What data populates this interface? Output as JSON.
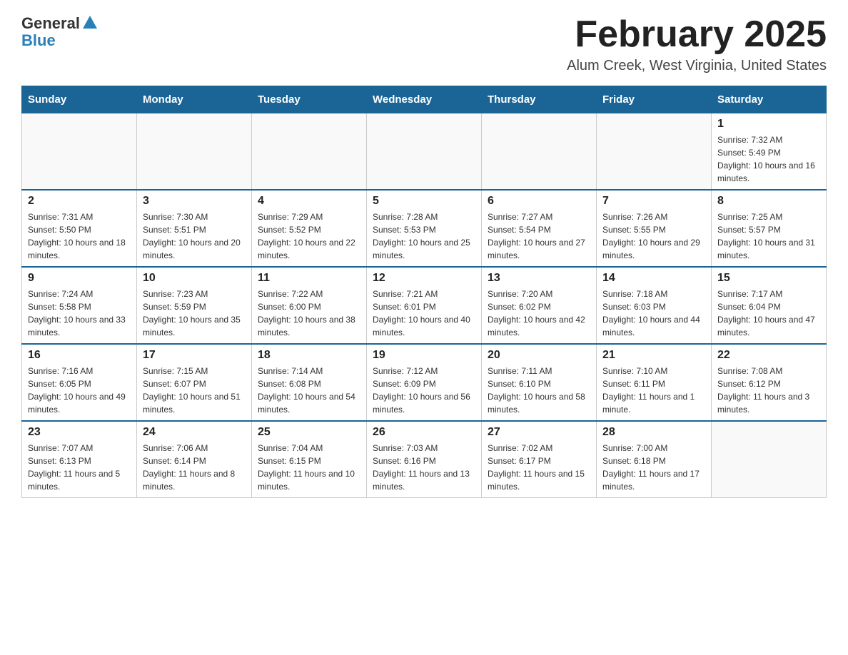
{
  "logo": {
    "general": "General",
    "blue": "Blue"
  },
  "title": "February 2025",
  "subtitle": "Alum Creek, West Virginia, United States",
  "days_header": [
    "Sunday",
    "Monday",
    "Tuesday",
    "Wednesday",
    "Thursday",
    "Friday",
    "Saturday"
  ],
  "weeks": [
    [
      {
        "day": "",
        "info": ""
      },
      {
        "day": "",
        "info": ""
      },
      {
        "day": "",
        "info": ""
      },
      {
        "day": "",
        "info": ""
      },
      {
        "day": "",
        "info": ""
      },
      {
        "day": "",
        "info": ""
      },
      {
        "day": "1",
        "info": "Sunrise: 7:32 AM\nSunset: 5:49 PM\nDaylight: 10 hours and 16 minutes."
      }
    ],
    [
      {
        "day": "2",
        "info": "Sunrise: 7:31 AM\nSunset: 5:50 PM\nDaylight: 10 hours and 18 minutes."
      },
      {
        "day": "3",
        "info": "Sunrise: 7:30 AM\nSunset: 5:51 PM\nDaylight: 10 hours and 20 minutes."
      },
      {
        "day": "4",
        "info": "Sunrise: 7:29 AM\nSunset: 5:52 PM\nDaylight: 10 hours and 22 minutes."
      },
      {
        "day": "5",
        "info": "Sunrise: 7:28 AM\nSunset: 5:53 PM\nDaylight: 10 hours and 25 minutes."
      },
      {
        "day": "6",
        "info": "Sunrise: 7:27 AM\nSunset: 5:54 PM\nDaylight: 10 hours and 27 minutes."
      },
      {
        "day": "7",
        "info": "Sunrise: 7:26 AM\nSunset: 5:55 PM\nDaylight: 10 hours and 29 minutes."
      },
      {
        "day": "8",
        "info": "Sunrise: 7:25 AM\nSunset: 5:57 PM\nDaylight: 10 hours and 31 minutes."
      }
    ],
    [
      {
        "day": "9",
        "info": "Sunrise: 7:24 AM\nSunset: 5:58 PM\nDaylight: 10 hours and 33 minutes."
      },
      {
        "day": "10",
        "info": "Sunrise: 7:23 AM\nSunset: 5:59 PM\nDaylight: 10 hours and 35 minutes."
      },
      {
        "day": "11",
        "info": "Sunrise: 7:22 AM\nSunset: 6:00 PM\nDaylight: 10 hours and 38 minutes."
      },
      {
        "day": "12",
        "info": "Sunrise: 7:21 AM\nSunset: 6:01 PM\nDaylight: 10 hours and 40 minutes."
      },
      {
        "day": "13",
        "info": "Sunrise: 7:20 AM\nSunset: 6:02 PM\nDaylight: 10 hours and 42 minutes."
      },
      {
        "day": "14",
        "info": "Sunrise: 7:18 AM\nSunset: 6:03 PM\nDaylight: 10 hours and 44 minutes."
      },
      {
        "day": "15",
        "info": "Sunrise: 7:17 AM\nSunset: 6:04 PM\nDaylight: 10 hours and 47 minutes."
      }
    ],
    [
      {
        "day": "16",
        "info": "Sunrise: 7:16 AM\nSunset: 6:05 PM\nDaylight: 10 hours and 49 minutes."
      },
      {
        "day": "17",
        "info": "Sunrise: 7:15 AM\nSunset: 6:07 PM\nDaylight: 10 hours and 51 minutes."
      },
      {
        "day": "18",
        "info": "Sunrise: 7:14 AM\nSunset: 6:08 PM\nDaylight: 10 hours and 54 minutes."
      },
      {
        "day": "19",
        "info": "Sunrise: 7:12 AM\nSunset: 6:09 PM\nDaylight: 10 hours and 56 minutes."
      },
      {
        "day": "20",
        "info": "Sunrise: 7:11 AM\nSunset: 6:10 PM\nDaylight: 10 hours and 58 minutes."
      },
      {
        "day": "21",
        "info": "Sunrise: 7:10 AM\nSunset: 6:11 PM\nDaylight: 11 hours and 1 minute."
      },
      {
        "day": "22",
        "info": "Sunrise: 7:08 AM\nSunset: 6:12 PM\nDaylight: 11 hours and 3 minutes."
      }
    ],
    [
      {
        "day": "23",
        "info": "Sunrise: 7:07 AM\nSunset: 6:13 PM\nDaylight: 11 hours and 5 minutes."
      },
      {
        "day": "24",
        "info": "Sunrise: 7:06 AM\nSunset: 6:14 PM\nDaylight: 11 hours and 8 minutes."
      },
      {
        "day": "25",
        "info": "Sunrise: 7:04 AM\nSunset: 6:15 PM\nDaylight: 11 hours and 10 minutes."
      },
      {
        "day": "26",
        "info": "Sunrise: 7:03 AM\nSunset: 6:16 PM\nDaylight: 11 hours and 13 minutes."
      },
      {
        "day": "27",
        "info": "Sunrise: 7:02 AM\nSunset: 6:17 PM\nDaylight: 11 hours and 15 minutes."
      },
      {
        "day": "28",
        "info": "Sunrise: 7:00 AM\nSunset: 6:18 PM\nDaylight: 11 hours and 17 minutes."
      },
      {
        "day": "",
        "info": ""
      }
    ]
  ]
}
